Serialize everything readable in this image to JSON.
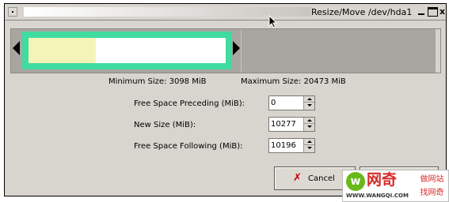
{
  "window": {
    "title": "Resize/Move /dev/hda1",
    "close_glyph": "x"
  },
  "partition": {
    "used_fraction": 0.34,
    "min_size_label": "Minimum Size: 3098 MiB",
    "max_size_label": "Maximum Size: 20473 MiB"
  },
  "form": {
    "free_preceding": {
      "label": "Free Space Preceding (MiB):",
      "value": "0"
    },
    "new_size": {
      "label": "New Size (MiB):",
      "value": "10277"
    },
    "free_following": {
      "label": "Free Space Following (MiB):",
      "value": "10196"
    }
  },
  "buttons": {
    "cancel_label": "Cancel",
    "cancel_icon": "x-icon"
  },
  "watermark": {
    "logo_letter": "w",
    "brand": "网奇",
    "url": "WWW.WANGQI.COM",
    "side_line1": "做网站",
    "side_line2": "找网奇"
  },
  "colors": {
    "partition_border": "#3fdb9f",
    "used_space": "#f5f4b8",
    "unallocated": "#a9a6a1"
  }
}
